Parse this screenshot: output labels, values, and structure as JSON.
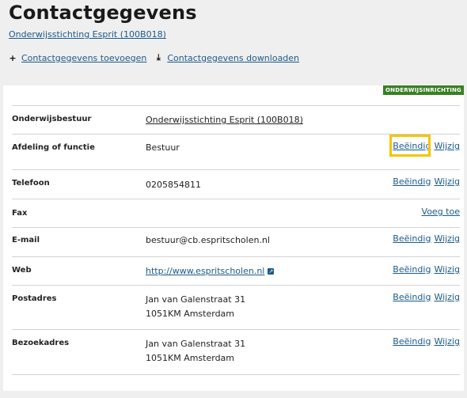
{
  "page": {
    "title": "Contactgegevens",
    "subtitle_link": "Onderwijsstichting Esprit (100B018)"
  },
  "actions": [
    {
      "icon": "plus-icon",
      "label": "Contactgegevens toevoegen"
    },
    {
      "icon": "download-icon",
      "label": "Contactgegevens downloaden"
    }
  ],
  "badge": "ONDERWIJSINRICHTING",
  "rows": [
    {
      "label": "Onderwijsbestuur",
      "value": "Onderwijsstichting Esprit (100B018)",
      "value_is_link": true
    },
    {
      "label": "Afdeling of functie",
      "value": "Bestuur",
      "end": "Beëindig",
      "edit": "Wijzig"
    },
    {
      "label": "Telefoon",
      "value": "0205854811",
      "end": "Beëindig",
      "edit": "Wijzig"
    },
    {
      "label": "Fax",
      "add": "Voeg toe"
    },
    {
      "label": "E-mail",
      "value": "bestuur@cb.espritscholen.nl",
      "end": "Beëindig",
      "edit": "Wijzig"
    },
    {
      "label": "Web",
      "value": "http://www.espritscholen.nl",
      "value_is_link": true,
      "end": "Beëindig",
      "edit": "Wijzig"
    },
    {
      "label": "Postadres",
      "line1": "Jan van Galenstraat 31",
      "line2": "1051KM Amsterdam",
      "end": "Beëindig",
      "edit": "Wijzig"
    },
    {
      "label": "Bezoekadres",
      "line1": "Jan van Galenstraat 31",
      "line2": "1051KM Amsterdam",
      "end": "Beëindig",
      "edit": "Wijzig"
    }
  ]
}
